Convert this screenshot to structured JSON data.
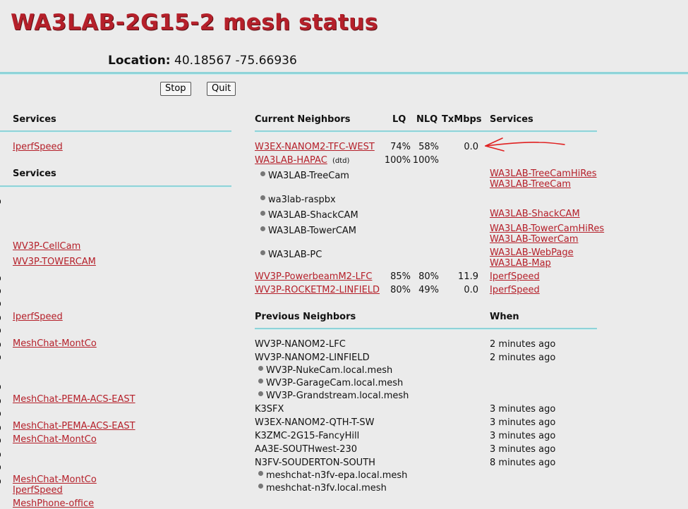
{
  "title": "WA3LAB-2G15-2 mesh status",
  "location": {
    "label": "Location:",
    "value": "40.18567 -75.66936"
  },
  "buttons": {
    "stop": "Stop",
    "quit": "Quit"
  },
  "left": {
    "header1": "Services",
    "header2": "Services",
    "links": [
      "IperfSpeed",
      "WV3P-CellCam",
      "WV3P-TOWERCAM",
      "IperfSpeed",
      "MeshChat-MontCo",
      "MeshChat-PEMA-ACS-EAST",
      "MeshChat-PEMA-ACS-EAST",
      "MeshChat-MontCo",
      "MeshChat-MontCo",
      "IperfSpeed",
      "MeshPhone-office"
    ]
  },
  "current": {
    "headers": {
      "neighbors": "Current Neighbors",
      "lq": "LQ",
      "nlq": "NLQ",
      "tx": "TxMbps",
      "services": "Services"
    },
    "rows": [
      {
        "name": "W3EX-NANOM2-TFC-WEST",
        "lq": "74%",
        "nlq": "58%",
        "tx": "0.0"
      },
      {
        "name": "WA3LAB-HAPAC",
        "tag": "(dtd)",
        "lq": "100%",
        "nlq": "100%"
      },
      {
        "name": "WV3P-PowerbeamM2-LFC",
        "lq": "85%",
        "nlq": "80%",
        "tx": "11.9",
        "service": "IperfSpeed"
      },
      {
        "name": "WV3P-ROCKETM2-LINFIELD",
        "lq": "80%",
        "nlq": "49%",
        "tx": "0.0",
        "service": "IperfSpeed"
      }
    ],
    "hosts": [
      {
        "name": "WA3LAB-TreeCam",
        "services": [
          "WA3LAB-TreeCamHiRes",
          "WA3LAB-TreeCam"
        ]
      },
      {
        "name": "wa3lab-raspbx",
        "services": []
      },
      {
        "name": "WA3LAB-ShackCAM",
        "services": [
          "WA3LAB-ShackCAM"
        ]
      },
      {
        "name": "WA3LAB-TowerCAM",
        "services": [
          "WA3LAB-TowerCamHiRes",
          "WA3LAB-TowerCam"
        ]
      },
      {
        "name": "WA3LAB-PC",
        "services": [
          "WA3LAB-WebPage",
          "WA3LAB-Map"
        ]
      }
    ]
  },
  "previous": {
    "headers": {
      "neighbors": "Previous Neighbors",
      "when": "When"
    },
    "rows": [
      {
        "name": "WV3P-NANOM2-LFC",
        "when": "2 minutes ago"
      },
      {
        "name": "WV3P-NANOM2-LINFIELD",
        "when": "2 minutes ago"
      },
      {
        "name": "WV3P-NukeCam.local.mesh",
        "sub": true
      },
      {
        "name": "WV3P-GarageCam.local.mesh",
        "sub": true
      },
      {
        "name": "WV3P-Grandstream.local.mesh",
        "sub": true
      },
      {
        "name": "K3SFX",
        "when": "3 minutes ago"
      },
      {
        "name": "W3EX-NANOM2-QTH-T-SW",
        "when": "3 minutes ago"
      },
      {
        "name": "K3ZMC-2G15-FancyHill",
        "when": "3 minutes ago"
      },
      {
        "name": "AA3E-SOUTHwest-230",
        "when": "3 minutes ago"
      },
      {
        "name": "N3FV-SOUDERTON-SOUTH",
        "when": "8 minutes ago"
      },
      {
        "name": "meshchat-n3fv-epa.local.mesh",
        "sub": true
      },
      {
        "name": "meshchat-n3fv.local.mesh",
        "sub": true
      }
    ]
  },
  "annotation_color": "#e02020"
}
